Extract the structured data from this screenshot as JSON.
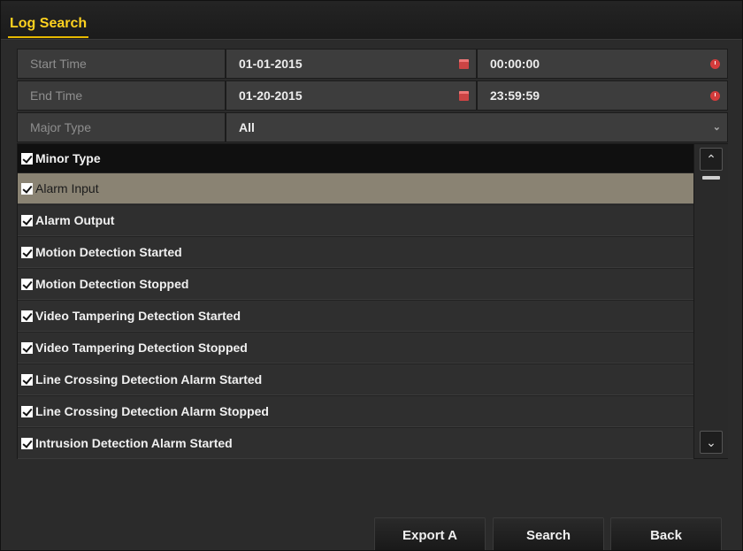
{
  "window": {
    "title": "Log Search"
  },
  "form": {
    "start_time": {
      "label": "Start Time",
      "date": "01-01-2015",
      "time": "00:00:00"
    },
    "end_time": {
      "label": "End Time",
      "date": "01-20-2015",
      "time": "23:59:59"
    },
    "major_type": {
      "label": "Major Type",
      "value": "All"
    }
  },
  "minor_type": {
    "header": "Minor Type",
    "items": [
      {
        "label": "Alarm Input",
        "checked": true,
        "selected": true
      },
      {
        "label": "Alarm Output",
        "checked": true,
        "selected": false
      },
      {
        "label": "Motion Detection Started",
        "checked": true,
        "selected": false
      },
      {
        "label": "Motion Detection Stopped",
        "checked": true,
        "selected": false
      },
      {
        "label": "Video Tampering Detection Started",
        "checked": true,
        "selected": false
      },
      {
        "label": "Video Tampering Detection Stopped",
        "checked": true,
        "selected": false
      },
      {
        "label": "Line Crossing Detection Alarm Started",
        "checked": true,
        "selected": false
      },
      {
        "label": "Line Crossing Detection Alarm Stopped",
        "checked": true,
        "selected": false
      },
      {
        "label": "Intrusion Detection Alarm Started",
        "checked": true,
        "selected": false
      }
    ]
  },
  "buttons": {
    "export": "Export A",
    "search": "Search",
    "back": "Back"
  },
  "icons": {
    "date_picker": "calendar-icon",
    "time_picker": "clock-icon",
    "dropdown": "chevron-down-icon",
    "scroll_up": "chevron-up-icon",
    "scroll_down": "chevron-down-icon",
    "checkbox": "checkbox-checked-icon"
  },
  "colors": {
    "title_accent": "#ffd21f",
    "selected_row": "#8a8373",
    "picker_icon": "#d43c3c"
  }
}
